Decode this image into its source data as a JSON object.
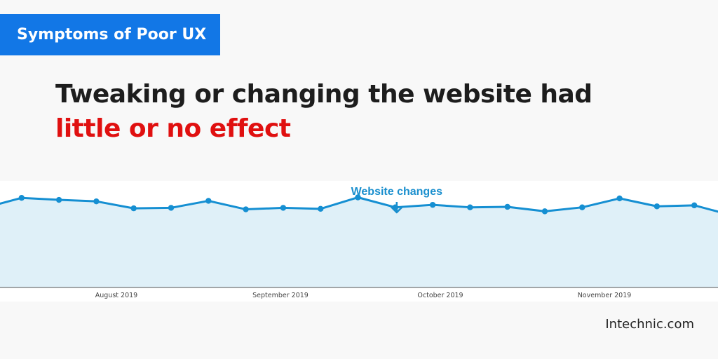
{
  "badge": {
    "text": "Symptoms of Poor UX"
  },
  "headline": {
    "line1": "Tweaking or changing the website had",
    "line2": "little or no effect"
  },
  "brand": "Intechnic.com",
  "colors": {
    "badge_bg": "#1277e6",
    "accent_red": "#e01010",
    "series_line": "#158fd2",
    "series_fill": "#dff0f8",
    "annotation": "#1a8fce"
  },
  "chart_data": {
    "type": "area",
    "title": "",
    "xlabel": "",
    "ylabel": "",
    "x_tick_labels": [
      "August 2019",
      "September 2019",
      "October 2019",
      "November 2019"
    ],
    "grid": true,
    "legend": "none",
    "series": [
      {
        "values": [
          16,
          18,
          17.6,
          17.3,
          15.9,
          16,
          17.4,
          15.7,
          16,
          15.8,
          18.1,
          16.1,
          16.6,
          16.1,
          16.2,
          15.3,
          16.1,
          17.9,
          16.3,
          16.5,
          14.5
        ]
      }
    ],
    "ylim": [
      0,
      20
    ],
    "annotations": [
      {
        "text": "Website changes",
        "point_index": 11
      }
    ]
  }
}
